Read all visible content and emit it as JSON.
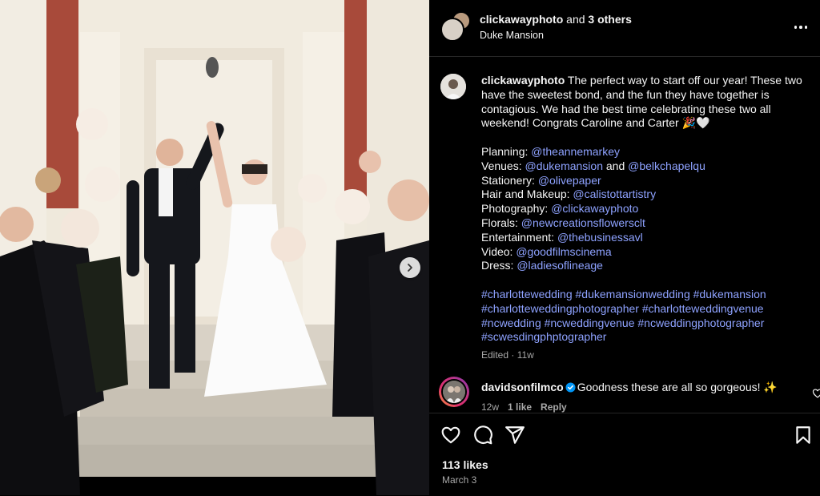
{
  "header": {
    "username": "clickawayphoto",
    "and_text": "and",
    "others_text": "3 others",
    "location": "Duke Mansion"
  },
  "caption": {
    "username": "clickawayphoto",
    "text_lines": [
      "The perfect way to start off our year! These two",
      "have the sweetest bond, and the fun they have together is",
      "contagious. We had the best time celebrating these two all",
      "weekend! Congrats Caroline and Carter 🎉🤍"
    ],
    "credits": [
      {
        "label": "Planning:",
        "handle": "@theannemarkey"
      },
      {
        "label": "Venues:",
        "handle": "@dukemansion",
        "joiner": "and",
        "handle2": "@belkchapelqu"
      },
      {
        "label": "Stationery:",
        "handle": "@olivepaper"
      },
      {
        "label": "Hair and Makeup:",
        "handle": "@calistottartistry"
      },
      {
        "label": "Photography:",
        "handle": "@clickawayphoto"
      },
      {
        "label": "Florals:",
        "handle": "@newcreationsflowersclt"
      },
      {
        "label": "Entertainment:",
        "handle": "@thebusinessavl"
      },
      {
        "label": "Video:",
        "handle": "@goodfilmscinema"
      },
      {
        "label": "Dress:",
        "handle": "@ladiesoflineage"
      }
    ],
    "hashtag_lines": [
      "#charlottewedding #dukemansionwedding #dukemansion",
      "#charlotteweddingphotographer #charlotteweddingvenue",
      "#ncwedding #ncweddingvenue #ncweddingphotographer",
      "#scwesdingphptographer"
    ],
    "edited": "Edited · 11w"
  },
  "comment": {
    "username": "davidsonfilmco",
    "text": "Goodness these are all so gorgeous! ✨",
    "age": "12w",
    "likes": "1 like",
    "reply": "Reply"
  },
  "footer": {
    "likes": "113 likes",
    "date": "March 3"
  },
  "icons": {
    "more": "more-options-icon",
    "like": "heart-icon",
    "comment": "comment-icon",
    "share": "share-icon",
    "save": "bookmark-icon",
    "next": "chevron-right-icon",
    "verified": "verified-badge-icon"
  },
  "colors": {
    "background": "#000000",
    "text": "#f5f5f5",
    "link": "#8ea2ff",
    "muted": "#a8a8a8",
    "verified": "#0095f6",
    "divider": "#262626"
  }
}
